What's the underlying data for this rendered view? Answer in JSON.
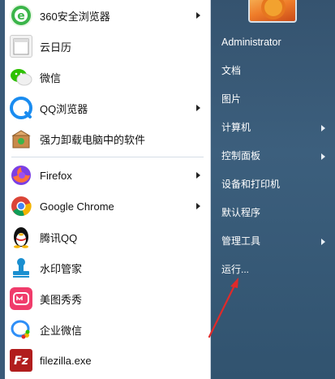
{
  "programs": [
    {
      "label": "360安全浏览器",
      "icon": "browser-360-icon",
      "color": "#3bb54a",
      "glyph": "e",
      "submenu": true
    },
    {
      "label": "云日历",
      "icon": "cloud-calendar-icon",
      "color": "#f4f4f4",
      "glyph": "",
      "submenu": false
    },
    {
      "label": "微信",
      "icon": "wechat-icon",
      "color": "#2dc100",
      "glyph": "",
      "submenu": false
    },
    {
      "label": "QQ浏览器",
      "icon": "qq-browser-icon",
      "color": "#1a8cf0",
      "glyph": "Q",
      "submenu": true
    },
    {
      "label": "强力卸载电脑中的软件",
      "icon": "uninstall-box-icon",
      "color": "#c98a4a",
      "glyph": "",
      "submenu": false
    },
    {
      "label": "Firefox",
      "icon": "firefox-icon",
      "color": "#ff7139",
      "glyph": "",
      "submenu": true
    },
    {
      "label": "Google Chrome",
      "icon": "chrome-icon",
      "color": "#4285f4",
      "glyph": "",
      "submenu": true
    },
    {
      "label": "腾讯QQ",
      "icon": "qq-penguin-icon",
      "color": "#ffffff",
      "glyph": "",
      "submenu": false
    },
    {
      "label": "水印管家",
      "icon": "watermark-stamp-icon",
      "color": "#1a8fd0",
      "glyph": "",
      "submenu": false
    },
    {
      "label": "美图秀秀",
      "icon": "meitu-icon",
      "color": "#f03c6b",
      "glyph": "",
      "submenu": false
    },
    {
      "label": "企业微信",
      "icon": "wecom-icon",
      "color": "#2f8ff7",
      "glyph": "",
      "submenu": false
    },
    {
      "label": "filezilla.exe",
      "icon": "filezilla-icon",
      "color": "#b11d1d",
      "glyph": "Fz",
      "submenu": false
    }
  ],
  "user": {
    "name": "Administrator",
    "avatar_icon": "flower-avatar-icon"
  },
  "places": [
    {
      "label": "文档",
      "submenu": false
    },
    {
      "label": "图片",
      "submenu": false
    },
    {
      "label": "计算机",
      "submenu": true
    },
    {
      "label": "控制面板",
      "submenu": true
    },
    {
      "label": "设备和打印机",
      "submenu": false
    },
    {
      "label": "默认程序",
      "submenu": false
    },
    {
      "label": "管理工具",
      "submenu": true
    },
    {
      "label": "运行...",
      "submenu": false
    }
  ],
  "annotation": {
    "arrow_color": "#e02a2a",
    "icon": "red-pointer-arrow-icon"
  }
}
